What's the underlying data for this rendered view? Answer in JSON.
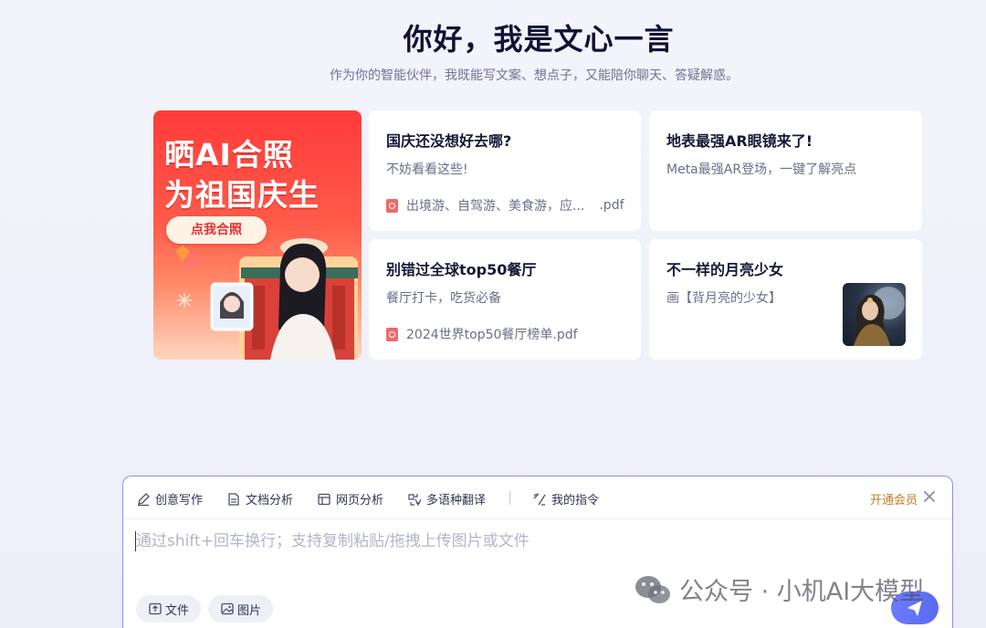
{
  "hero": {
    "title": "你好，我是文心一言",
    "subtitle": "作为你的智能伙伴，我既能写文案、想点子，又能陪你聊天、答疑解惑。"
  },
  "banner": {
    "line1": "晒AI合照",
    "line2": "为祖国庆生",
    "button_label": "点我合照"
  },
  "cards": [
    {
      "title": "国庆还没想好去哪?",
      "desc": "不妨看看这些!",
      "file_name": "出境游、自驾游、美食游，应...",
      "file_ext": ".pdf",
      "file_icon": "pdf-icon"
    },
    {
      "title": "地表最强AR眼镜来了!",
      "desc": "Meta最强AR登场，一键了解亮点"
    },
    {
      "title": "别错过全球top50餐厅",
      "desc": "餐厅打卡，吃货必备",
      "file_name": "2024世界top50餐厅榜单.pdf",
      "file_icon": "pdf-icon"
    },
    {
      "title": "不一样的月亮少女",
      "desc": "画【背月亮的少女】",
      "thumb_icon": "moon-girl-thumbnail"
    }
  ],
  "toolbar": {
    "tools": [
      {
        "label": "创意写作",
        "icon": "pen-icon"
      },
      {
        "label": "文档分析",
        "icon": "document-icon"
      },
      {
        "label": "网页分析",
        "icon": "webpage-icon"
      },
      {
        "label": "多语种翻译",
        "icon": "translate-icon"
      },
      {
        "label": "我的指令",
        "icon": "command-icon"
      }
    ],
    "vip_label": "开通会员",
    "close_icon": "close-icon"
  },
  "input": {
    "placeholder": "通过shift+回车换行；支持复制粘贴/拖拽上传图片或文件",
    "value": ""
  },
  "attachments": {
    "file_label": "文件",
    "image_label": "图片"
  },
  "send_icon": "send-icon",
  "watermark": {
    "text": "公众号 · 小机AI大模型",
    "icon": "wechat-icon"
  },
  "colors": {
    "accent": "#5a6af0",
    "input_border": "#8f8cf5",
    "vip": "#c27a24",
    "banner_red": "#ff3b3b"
  }
}
